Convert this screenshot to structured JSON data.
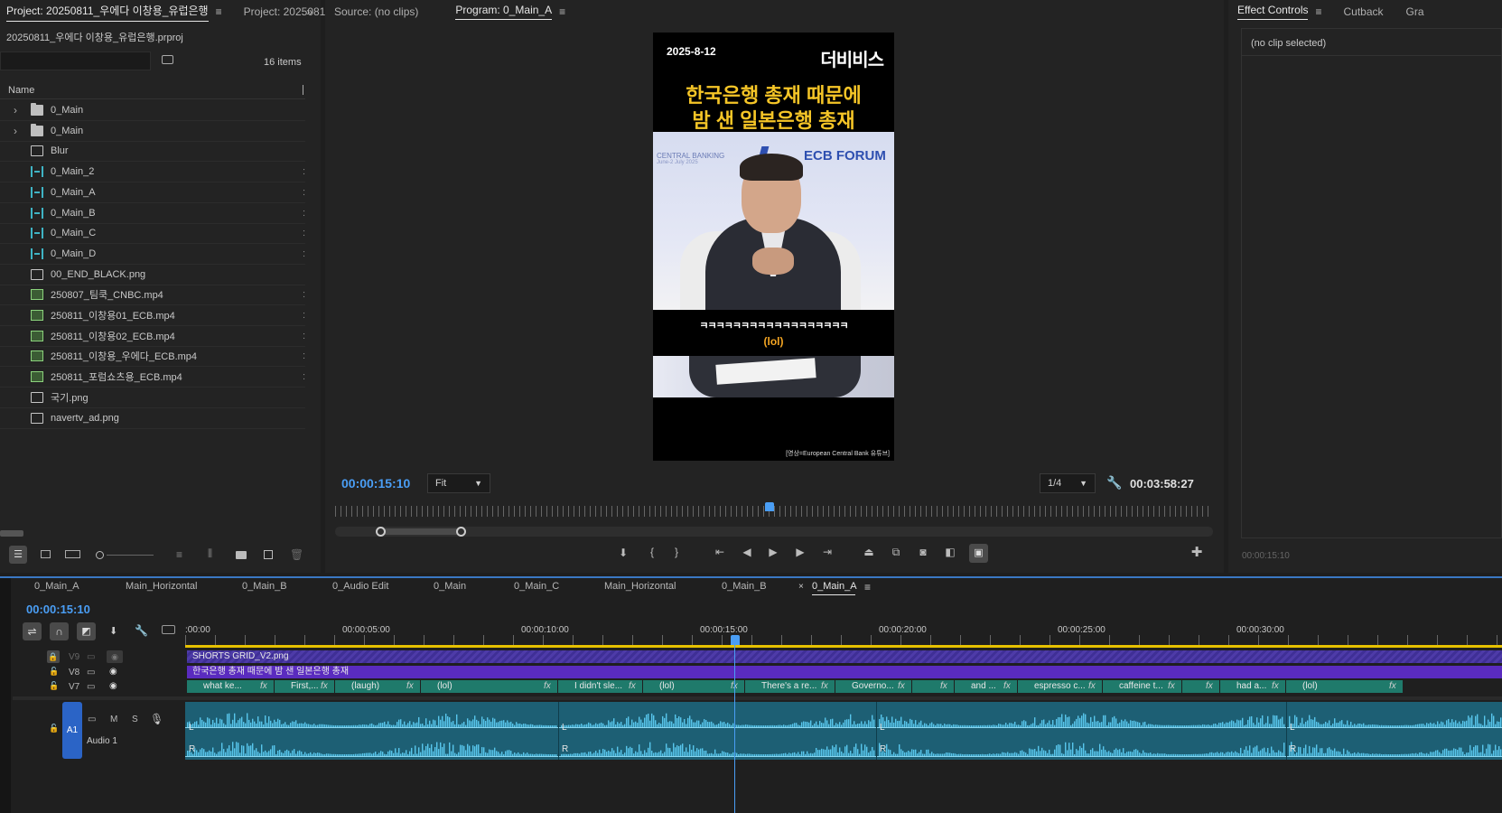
{
  "project_panel": {
    "tab_active": "Project: 20250811_우에다 이창용_유럽은행",
    "tab_other": "Project: 2025081",
    "file_name": "20250811_우에다 이창용_유럽은행.prproj",
    "item_count": "16 items",
    "column_name": "Name",
    "items": [
      {
        "icon": "folder",
        "label": "0_Main",
        "expandable": true
      },
      {
        "icon": "folder",
        "label": "0_Main",
        "expandable": true
      },
      {
        "icon": "still",
        "label": "Blur"
      },
      {
        "icon": "sequence",
        "label": "0_Main_2"
      },
      {
        "icon": "sequence",
        "label": "0_Main_A"
      },
      {
        "icon": "sequence",
        "label": "0_Main_B"
      },
      {
        "icon": "sequence",
        "label": "0_Main_C"
      },
      {
        "icon": "sequence",
        "label": "0_Main_D"
      },
      {
        "icon": "still",
        "label": "00_END_BLACK.png"
      },
      {
        "icon": "video",
        "label": "250807_팀쿡_CNBC.mp4"
      },
      {
        "icon": "video",
        "label": "250811_이창용01_ECB.mp4"
      },
      {
        "icon": "video",
        "label": "250811_이창용02_ECB.mp4"
      },
      {
        "icon": "video",
        "label": "250811_이창용_우에다_ECB.mp4"
      },
      {
        "icon": "video",
        "label": "250811_포럼쇼츠용_ECB.mp4"
      },
      {
        "icon": "still",
        "label": "국기.png"
      },
      {
        "icon": "still",
        "label": "navertv_ad.png"
      }
    ]
  },
  "source_monitor": {
    "tab": "Source: (no clips)"
  },
  "program_monitor": {
    "tab": "Program: 0_Main_A",
    "timecode": "00:00:15:10",
    "fit_label": "Fit",
    "resolution_label": "1/4",
    "duration": "00:03:58:27",
    "frame": {
      "date": "2025-8-12",
      "logo": "더비비스",
      "headline_line1": "한국은행 총재 때문에",
      "headline_line2": "밤 샌 일본은행 총재",
      "banner_left": "CENTRAL BANKING",
      "banner_left_sub": "June-2 July 2025",
      "banner_right": "ECB FORUM",
      "subtitle_ko": "ㅋㅋㅋㅋㅋㅋㅋㅋㅋㅋㅋㅋㅋㅋㅋㅋㅋㅋ",
      "subtitle_en": "(lol)",
      "credit": "[영상=European Central Bank 유튜브]"
    }
  },
  "effect_controls": {
    "tab_active": "Effect Controls",
    "tab2": "Cutback",
    "tab3": "Gra",
    "empty_text": "(no clip selected)",
    "timecode": "00:00:15:10"
  },
  "timeline": {
    "sequence_tabs": [
      "0_Main_A",
      "Main_Horizontal",
      "0_Main_B",
      "0_Audio Edit",
      "0_Main",
      "0_Main_C",
      "Main_Horizontal",
      "0_Main_B",
      "0_Main_A"
    ],
    "active_tab_index": 8,
    "timecode": "00:00:15:10",
    "ruler_labels": [
      ":00:00",
      "00:00:05:00",
      "00:00:10:00",
      "00:00:15:00",
      "00:00:20:00",
      "00:00:25:00",
      "00:00:30:00"
    ],
    "tracks": {
      "v9": "V9",
      "v8": "V8",
      "v7": "V7",
      "a1": "A1",
      "audio_name": "Audio 1",
      "mute": "M",
      "solo": "S"
    },
    "v9_clip": "SHORTS GRID_V2.png",
    "v8_clip": "한국은행 총재 때문에 밤 샌 일본은행 총재",
    "v7_clips": [
      "what ke...",
      "First,...",
      "(laugh)",
      "(lol)",
      "I didn't sle...",
      "(lol)",
      "There's a re...",
      "Governo...",
      "",
      "and ...",
      "espresso c...",
      "caffeine t...",
      "",
      "had a...",
      "(lol)"
    ],
    "fx_label": "fx",
    "channel_left": "L",
    "channel_right": "R"
  }
}
